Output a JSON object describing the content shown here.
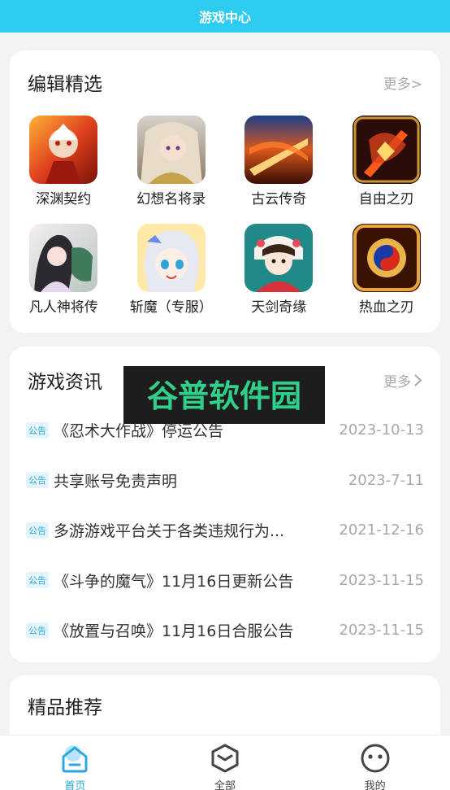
{
  "header": {
    "title": "游戏中心"
  },
  "editor_picks": {
    "title": "编辑精选",
    "more_label": "更多>",
    "games": [
      {
        "name": "深渊契约",
        "icon": "game-deep-abyss-icon"
      },
      {
        "name": "幻想名将录",
        "icon": "game-fantasy-generals-icon"
      },
      {
        "name": "古云传奇",
        "icon": "game-guyun-legend-icon"
      },
      {
        "name": "自由之刃",
        "icon": "game-freedom-blade-icon"
      },
      {
        "name": "凡人神将传",
        "icon": "game-mortal-general-icon"
      },
      {
        "name": "斩魔（专服）",
        "icon": "game-slay-demon-icon"
      },
      {
        "name": "天剑奇缘",
        "icon": "game-sky-sword-icon"
      },
      {
        "name": "热血之刃",
        "icon": "game-hot-blood-blade-icon"
      }
    ]
  },
  "news": {
    "title": "游戏资讯",
    "more_label": "更多",
    "items": [
      {
        "tag": "公告",
        "title": "《忍术大作战》停运公告",
        "date": "2023-10-13"
      },
      {
        "tag": "公告",
        "title": "共享账号免责声明",
        "date": "2023-7-11"
      },
      {
        "tag": "公告",
        "title": "多游游戏平台关于各类违规行为...",
        "date": "2021-12-16"
      },
      {
        "tag": "公告",
        "title": "《斗争的魔气》11月16日更新公告",
        "date": "2023-11-15"
      },
      {
        "tag": "公告",
        "title": "《放置与召唤》11月16日合服公告",
        "date": "2023-11-15"
      }
    ]
  },
  "recommend": {
    "title": "精品推荐"
  },
  "watermark": {
    "text": "谷普软件园"
  },
  "tabs": [
    {
      "label": "首页",
      "icon": "home-icon",
      "active": true
    },
    {
      "label": "全部",
      "icon": "cube-icon",
      "active": false
    },
    {
      "label": "我的",
      "icon": "smiley-profile-icon",
      "active": false
    }
  ],
  "colors": {
    "accent": "#2ecbf0",
    "active_tab": "#2aa8e0",
    "muted": "#a8a8a8"
  }
}
